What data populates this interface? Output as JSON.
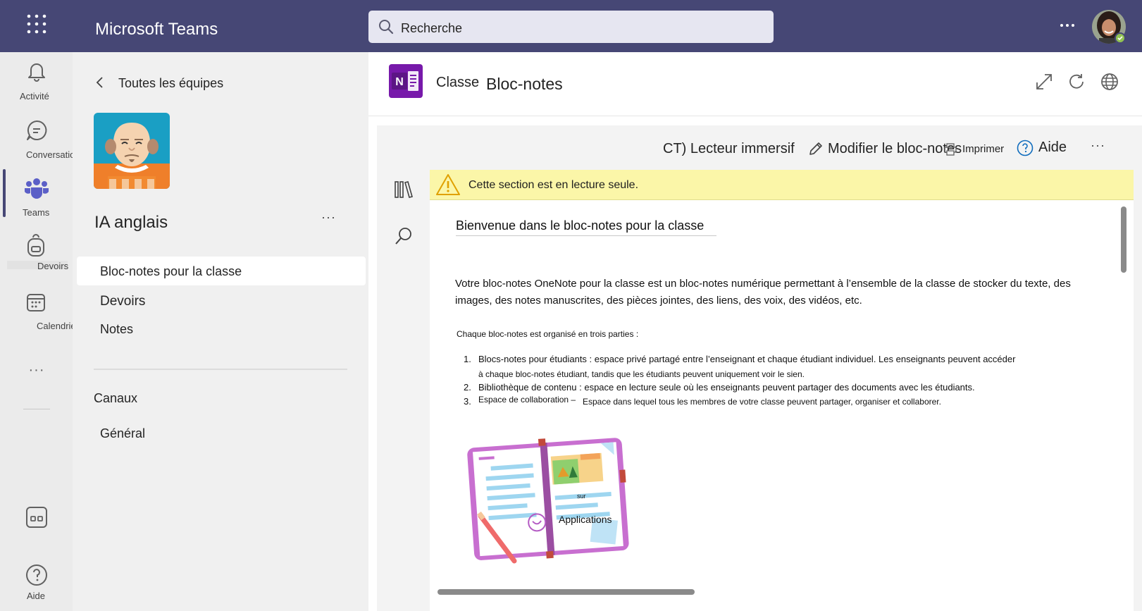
{
  "app": {
    "title": "Microsoft Teams"
  },
  "search": {
    "placeholder": "Recherche"
  },
  "rail": {
    "items": [
      {
        "label": "Activité",
        "icon": "bell-icon"
      },
      {
        "label": "Conversation",
        "icon": "chat-icon"
      },
      {
        "label": "Teams",
        "icon": "teams-icon"
      },
      {
        "label": "Devoirs",
        "icon": "backpack-icon"
      },
      {
        "label": "Calendrier",
        "icon": "calendar-icon"
      }
    ],
    "more": "···",
    "help": "Aide"
  },
  "team_panel": {
    "back_label": "Toutes les équipes",
    "team_name": "IA anglais",
    "more": "···",
    "items": [
      {
        "label": "Bloc-notes pour la classe"
      },
      {
        "label": "Devoirs"
      },
      {
        "label": "Notes"
      }
    ],
    "channels_header": "Canaux",
    "channels": [
      {
        "label": "Général"
      }
    ]
  },
  "notebook_header": {
    "classe": "Classe",
    "title": "Bloc-notes"
  },
  "toolbar": {
    "immersive_reader": "CT) Lecteur immersif",
    "edit_notebook": "Modifier le bloc-notes",
    "print": "Imprimer",
    "help": "Aide",
    "more": "···"
  },
  "banner": {
    "text": "Cette section est en lecture seule."
  },
  "page": {
    "title": "Bienvenue dans le bloc-notes pour la classe",
    "intro_line1": "Votre bloc-notes OneNote pour la classe est un bloc-notes numérique permettant à l’ensemble de la classe de stocker du texte, des",
    "intro_line2": "images, des notes manuscrites, des pièces jointes, des liens, des voix, des vidéos, etc.",
    "parts_intro": "Chaque bloc-notes est organisé en trois parties :",
    "list": [
      {
        "num": "1.",
        "line1": "Blocs-notes pour étudiants : espace privé partagé entre l’enseignant et chaque étudiant individuel. Les enseignants peuvent accéder",
        "line2": "à chaque bloc-notes étudiant, tandis que les étudiants peuvent uniquement voir le sien."
      },
      {
        "num": "2.",
        "line1": "Bibliothèque de contenu : espace en lecture seule où les enseignants peuvent partager des documents avec les étudiants."
      },
      {
        "num": "3.",
        "term": "Espace de collaboration –",
        "line1": "Espace dans lequel tous les membres de votre classe peuvent partager, organiser et collaborer."
      }
    ],
    "illustration_small": "sur",
    "illustration_label": "Applications"
  }
}
